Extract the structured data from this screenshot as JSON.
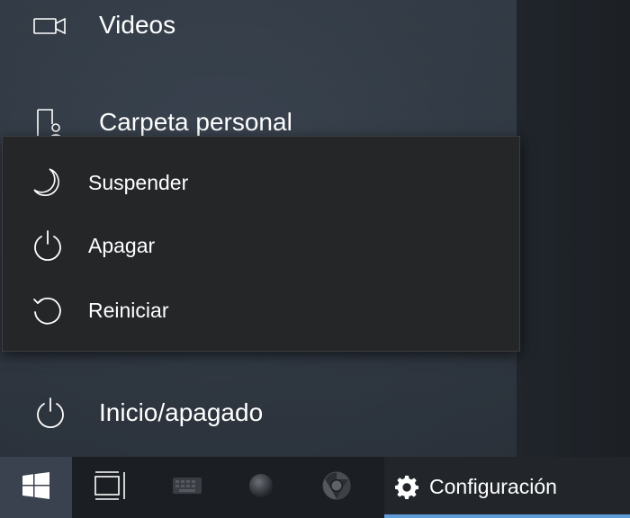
{
  "start_menu": {
    "items": [
      {
        "label": "Videos",
        "icon": "video-icon"
      },
      {
        "label": "Carpeta personal",
        "icon": "user-folder-icon"
      },
      {
        "label": "Inicio/apagado",
        "icon": "power-icon"
      }
    ]
  },
  "power_flyout": {
    "items": [
      {
        "label": "Suspender",
        "icon": "moon-icon"
      },
      {
        "label": "Apagar",
        "icon": "power-icon"
      },
      {
        "label": "Reiniciar",
        "icon": "restart-icon"
      }
    ]
  },
  "taskbar": {
    "settings_label": "Configuración",
    "accent_color": "#5f9bd6"
  }
}
